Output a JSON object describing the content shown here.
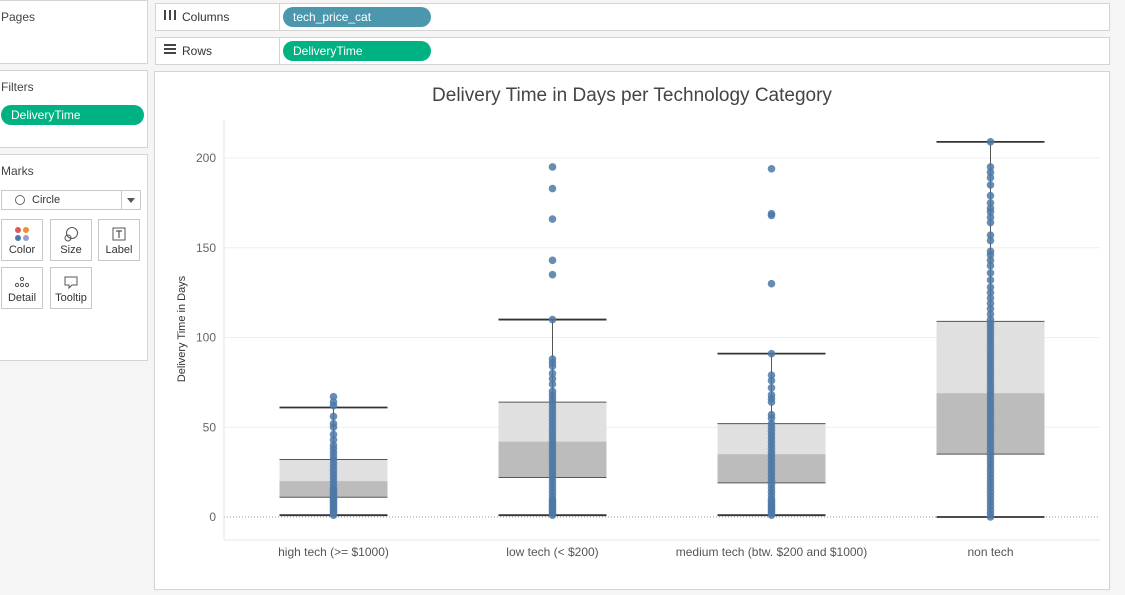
{
  "left": {
    "pages_title": "Pages",
    "filters_title": "Filters",
    "filter_pill": "DeliveryTime",
    "marks_title": "Marks",
    "mark_type": "Circle",
    "mark_buttons": {
      "color": "Color",
      "size": "Size",
      "label": "Label",
      "detail": "Detail",
      "tooltip": "Tooltip"
    }
  },
  "shelves": {
    "columns_label": "Columns",
    "columns_pill": "tech_price_cat",
    "rows_label": "Rows",
    "rows_pill": "DeliveryTime"
  },
  "colors": {
    "green_pill": "#00b181",
    "blue_pill": "#4b97ad",
    "dot": "#4e79a7",
    "box_upper": "#e0e0e0",
    "box_lower": "#bcbcbc",
    "whisker": "#333333"
  },
  "chart_data": {
    "type": "box",
    "title": "Delivery Time in Days per Technology Category",
    "ylabel": "Delivery Time in Days",
    "xlabel": "",
    "ylim": [
      -10,
      220
    ],
    "yticks": [
      0,
      50,
      100,
      150,
      200
    ],
    "categories": [
      "high tech (>= $1000)",
      "low tech (< $200)",
      "medium tech (btw. $200 and $1000)",
      "non tech"
    ],
    "boxes": [
      {
        "category": "high tech (>= $1000)",
        "whisker_low": 1,
        "q1": 11,
        "median": 20,
        "q3": 32,
        "whisker_high": 61,
        "outliers": [
          62,
          64,
          67
        ],
        "points": [
          1,
          2,
          3,
          4,
          5,
          6,
          7,
          8,
          9,
          10,
          11,
          12,
          13,
          14,
          15,
          16,
          18,
          20,
          22,
          24,
          26,
          28,
          30,
          32,
          34,
          36,
          38,
          40,
          43,
          46,
          50,
          52,
          56,
          62,
          64,
          67
        ]
      },
      {
        "category": "low tech (< $200)",
        "whisker_low": 1,
        "q1": 22,
        "median": 42,
        "q3": 64,
        "whisker_high": 110,
        "outliers": [
          135,
          143,
          166,
          183,
          195
        ],
        "points": [
          1,
          2,
          3,
          4,
          5,
          6,
          7,
          8,
          9,
          10,
          12,
          14,
          16,
          18,
          20,
          22,
          24,
          26,
          28,
          30,
          32,
          34,
          36,
          38,
          40,
          42,
          44,
          46,
          48,
          50,
          52,
          54,
          56,
          58,
          60,
          62,
          64,
          66,
          68,
          70,
          74,
          77,
          80,
          84,
          86,
          88,
          110,
          135,
          143,
          166,
          183,
          195
        ]
      },
      {
        "category": "medium tech (btw. $200 and $1000)",
        "whisker_low": 1,
        "q1": 19,
        "median": 35,
        "q3": 52,
        "whisker_high": 91,
        "outliers": [
          130,
          168,
          169,
          194
        ],
        "points": [
          1,
          2,
          3,
          4,
          5,
          6,
          7,
          8,
          9,
          10,
          12,
          14,
          16,
          18,
          20,
          22,
          24,
          26,
          28,
          30,
          32,
          34,
          36,
          38,
          40,
          42,
          44,
          46,
          48,
          50,
          52,
          55,
          57,
          64,
          66,
          68,
          72,
          76,
          79,
          91,
          130,
          168,
          169,
          194
        ]
      },
      {
        "category": "non tech",
        "whisker_low": 0,
        "q1": 35,
        "median": 69,
        "q3": 109,
        "whisker_high": 209,
        "outliers": [],
        "points": [
          0,
          2,
          4,
          6,
          8,
          10,
          12,
          14,
          16,
          18,
          20,
          22,
          24,
          26,
          28,
          30,
          32,
          34,
          36,
          38,
          40,
          42,
          44,
          46,
          48,
          50,
          52,
          54,
          56,
          58,
          60,
          62,
          64,
          66,
          68,
          70,
          72,
          74,
          76,
          78,
          80,
          82,
          84,
          86,
          88,
          90,
          92,
          94,
          96,
          98,
          100,
          102,
          104,
          106,
          108,
          110,
          113,
          116,
          119,
          122,
          125,
          128,
          132,
          136,
          140,
          143,
          146,
          148,
          154,
          157,
          164,
          167,
          170,
          172,
          175,
          179,
          185,
          189,
          192,
          195,
          209
        ]
      }
    ],
    "grid": true,
    "legend": "none"
  }
}
